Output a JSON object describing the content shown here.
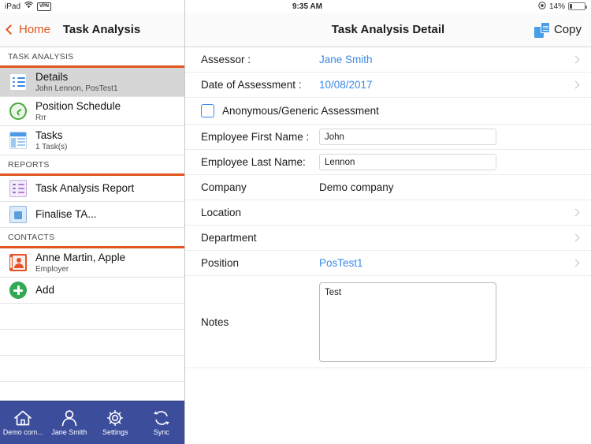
{
  "statusbar": {
    "device": "iPad",
    "wifi_icon": "wifi-icon",
    "vpn_label": "VPN",
    "time": "9:35 AM",
    "location_icon": "location-services-icon",
    "battery_percent": "14%",
    "battery_icon": "battery-icon"
  },
  "sidebar": {
    "back_label": "Home",
    "title": "Task Analysis",
    "sections": [
      {
        "header": "TASK ANALYSIS",
        "items": [
          {
            "icon": "list-icon",
            "title": "Details",
            "subtitle": "John Lennon, PosTest1",
            "selected": true
          },
          {
            "icon": "clock-icon",
            "title": "Position Schedule",
            "subtitle": "Rrr",
            "selected": false
          },
          {
            "icon": "table-icon",
            "title": "Tasks",
            "subtitle": "1 Task(s)",
            "selected": false
          }
        ]
      },
      {
        "header": "REPORTS",
        "items": [
          {
            "icon": "report-icon",
            "title": "Task Analysis Report",
            "subtitle": "",
            "selected": false
          },
          {
            "icon": "document-icon",
            "title": "Finalise TA...",
            "subtitle": "",
            "selected": false
          }
        ]
      },
      {
        "header": "CONTACTS",
        "items": [
          {
            "icon": "contact-card-icon",
            "title": "Anne Martin, Apple",
            "subtitle": "Employer",
            "selected": false
          },
          {
            "icon": "add-icon",
            "title": "Add",
            "subtitle": "",
            "selected": false
          }
        ]
      }
    ]
  },
  "tabbar": {
    "tabs": [
      {
        "icon": "home-icon",
        "label": "Demo com..."
      },
      {
        "icon": "person-icon",
        "label": "Jane Smith"
      },
      {
        "icon": "gear-icon",
        "label": "Settings"
      },
      {
        "icon": "sync-icon",
        "label": "Sync"
      }
    ]
  },
  "detail": {
    "title": "Task Analysis Detail",
    "copy_label": "Copy",
    "copy_icon": "copy-icon",
    "rows": {
      "assessor": {
        "label": "Assessor :",
        "value": "Jane Smith"
      },
      "date": {
        "label": "Date of Assessment :",
        "value": "10/08/2017"
      },
      "anonymous": {
        "label": "Anonymous/Generic Assessment",
        "checked": false
      },
      "first_name": {
        "label": "Employee First Name :",
        "value": "John",
        "placeholder": ""
      },
      "last_name": {
        "label": "Employee Last Name:",
        "value": "Lennon",
        "placeholder": ""
      },
      "company": {
        "label": "Company",
        "value": "Demo company"
      },
      "location": {
        "label": "Location",
        "value": ""
      },
      "department": {
        "label": "Department",
        "value": ""
      },
      "position": {
        "label": "Position",
        "value": "PosTest1"
      },
      "notes": {
        "label": "Notes",
        "value": "Test",
        "placeholder": ""
      }
    }
  },
  "colors": {
    "accent_orange": "#e2561f",
    "link_blue": "#3b8ae8",
    "tabbar_blue": "#3b4d9b",
    "selected_row": "#d6d6d6"
  }
}
